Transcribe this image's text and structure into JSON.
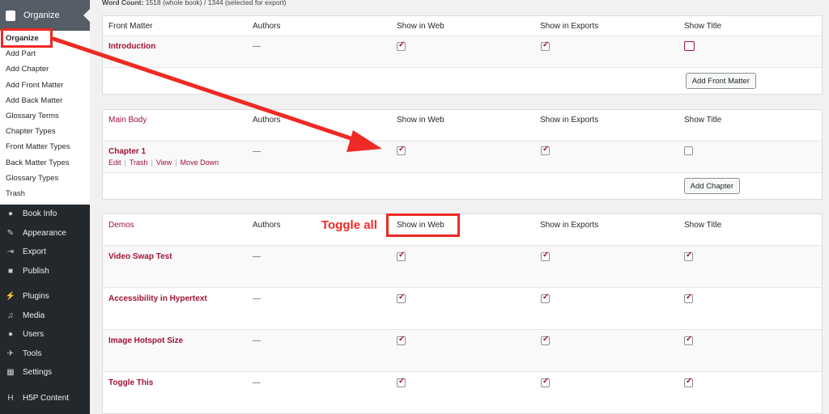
{
  "word_count": {
    "label": "Word Count:",
    "text": "1518 (whole book) / 1344 (selected for export)"
  },
  "sidebar": {
    "header": "Organize",
    "submenu": [
      "Organize",
      "Add Part",
      "Add Chapter",
      "Add Front Matter",
      "Add Back Matter",
      "Glossary Terms",
      "Chapter Types",
      "Front Matter Types",
      "Back Matter Types",
      "Glossary Types",
      "Trash"
    ],
    "main_items": [
      {
        "label": "Book Info",
        "icon": "info-icon"
      },
      {
        "label": "Appearance",
        "icon": "paintbrush-icon"
      },
      {
        "label": "Export",
        "icon": "export-icon"
      },
      {
        "label": "Publish",
        "icon": "publish-icon"
      },
      {
        "label": "Plugins",
        "icon": "plugin-icon"
      },
      {
        "label": "Media",
        "icon": "media-icon"
      },
      {
        "label": "Users",
        "icon": "users-icon"
      },
      {
        "label": "Tools",
        "icon": "tools-icon"
      },
      {
        "label": "Settings",
        "icon": "settings-icon"
      },
      {
        "label": "H5P Content",
        "icon": "h5p-icon"
      }
    ]
  },
  "columns": {
    "authors": "Authors",
    "show_web": "Show in Web",
    "show_exports": "Show in Exports",
    "show_title": "Show Title"
  },
  "front_matter": {
    "heading": "Front Matter",
    "rows": [
      {
        "title": "Introduction",
        "authors": "—",
        "web": true,
        "exports": true,
        "show_title": false
      }
    ],
    "button": "Add Front Matter"
  },
  "main_body": {
    "heading": "Main Body",
    "rows": [
      {
        "title": "Chapter 1",
        "authors": "—",
        "web": true,
        "exports": true,
        "show_title": false
      }
    ],
    "row_actions": [
      "Edit",
      "Trash",
      "View",
      "Move Down"
    ],
    "button": "Add Chapter"
  },
  "demos": {
    "heading": "Demos",
    "rows": [
      {
        "title": "Video Swap Test",
        "authors": "—",
        "web": true,
        "exports": true,
        "show_title": true
      },
      {
        "title": "Accessibility in Hypertext",
        "authors": "—",
        "web": true,
        "exports": true,
        "show_title": true
      },
      {
        "title": "Image Hotspot Size",
        "authors": "—",
        "web": true,
        "exports": true,
        "show_title": true
      },
      {
        "title": "Toggle This",
        "authors": "—",
        "web": true,
        "exports": true,
        "show_title": true
      }
    ]
  },
  "annotation": {
    "toggle_all": "Toggle all"
  },
  "colors": {
    "accent": "#a01235",
    "annotation": "#ee2a24",
    "sidebar": "#23282d"
  }
}
